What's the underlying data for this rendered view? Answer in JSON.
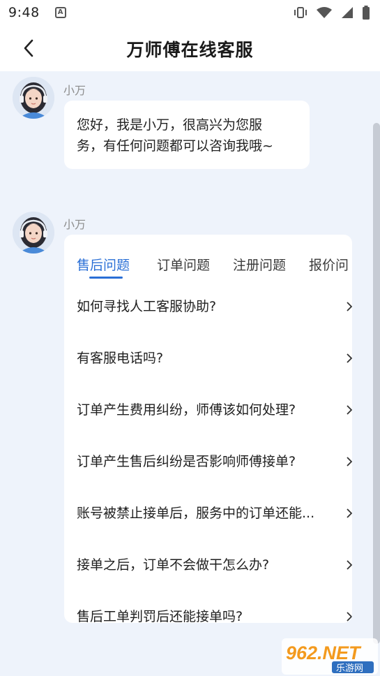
{
  "status_bar": {
    "time": "9:48",
    "notification_icon": "a-icon",
    "icons": [
      "vibrate-icon",
      "wifi-icon",
      "signal-icon",
      "battery-icon"
    ]
  },
  "header": {
    "back_icon": "chevron-left-icon",
    "title": "万师傅在线客服"
  },
  "messages": [
    {
      "sender": "小万",
      "text_line1": "您好，我是小万，很高兴为您服",
      "text_line2": "务，有任何问题都可以咨询我哦~"
    },
    {
      "sender": "小万",
      "tabs": [
        {
          "label": "售后问题",
          "active": true
        },
        {
          "label": "订单问题",
          "active": false
        },
        {
          "label": "注册问题",
          "active": false
        },
        {
          "label": "报价问",
          "active": false
        }
      ],
      "questions": [
        "如何寻找人工客服协助?",
        "有客服电话吗?",
        "订单产生费用纠纷，师傅该如何处理?",
        "订单产生售后纠纷是否影响师傅接单?",
        "账号被禁止接单后，服务中的订单还能...",
        "接单之后，订单不会做干怎么办?",
        "售后工单判罚后还能接单吗?"
      ]
    }
  ],
  "watermark": {
    "top": "962.NET",
    "bottom": "乐游网"
  },
  "colors": {
    "accent": "#2a6fd6",
    "background": "#eef3fb",
    "watermark_orange": "#f39a1e",
    "watermark_blue": "#2f6fbf"
  }
}
